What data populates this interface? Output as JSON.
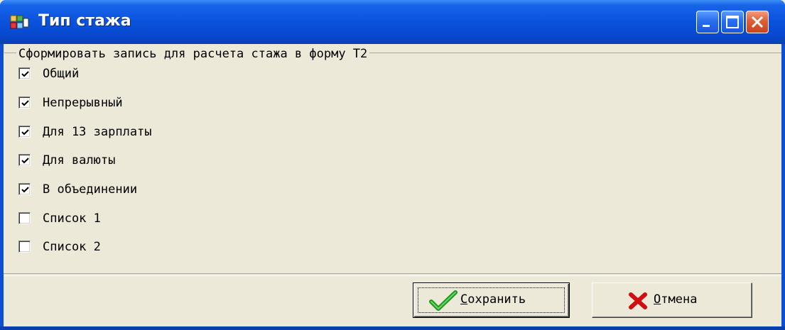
{
  "window": {
    "title": "Тип стажа"
  },
  "group": {
    "legend": "Сформировать запись для расчета стажа в форму Т2"
  },
  "checkboxes": [
    {
      "label": "Общий",
      "checked": true
    },
    {
      "label": "Непрерывный",
      "checked": true
    },
    {
      "label": "Для 13 зарплаты",
      "checked": true
    },
    {
      "label": "Для валюты",
      "checked": true
    },
    {
      "label": "В объединении",
      "checked": true
    },
    {
      "label": "Список 1",
      "checked": false
    },
    {
      "label": "Список 2",
      "checked": false
    }
  ],
  "buttons": {
    "save": {
      "accel": "С",
      "rest": "охранить",
      "icon": "checkmark-icon",
      "color": "#1a9a1a"
    },
    "cancel": {
      "accel": "О",
      "rest": "тмена",
      "icon": "red-x-icon",
      "color": "#d01010"
    }
  },
  "colors": {
    "titlebar": "#0a52dc",
    "face": "#ece9d8"
  }
}
